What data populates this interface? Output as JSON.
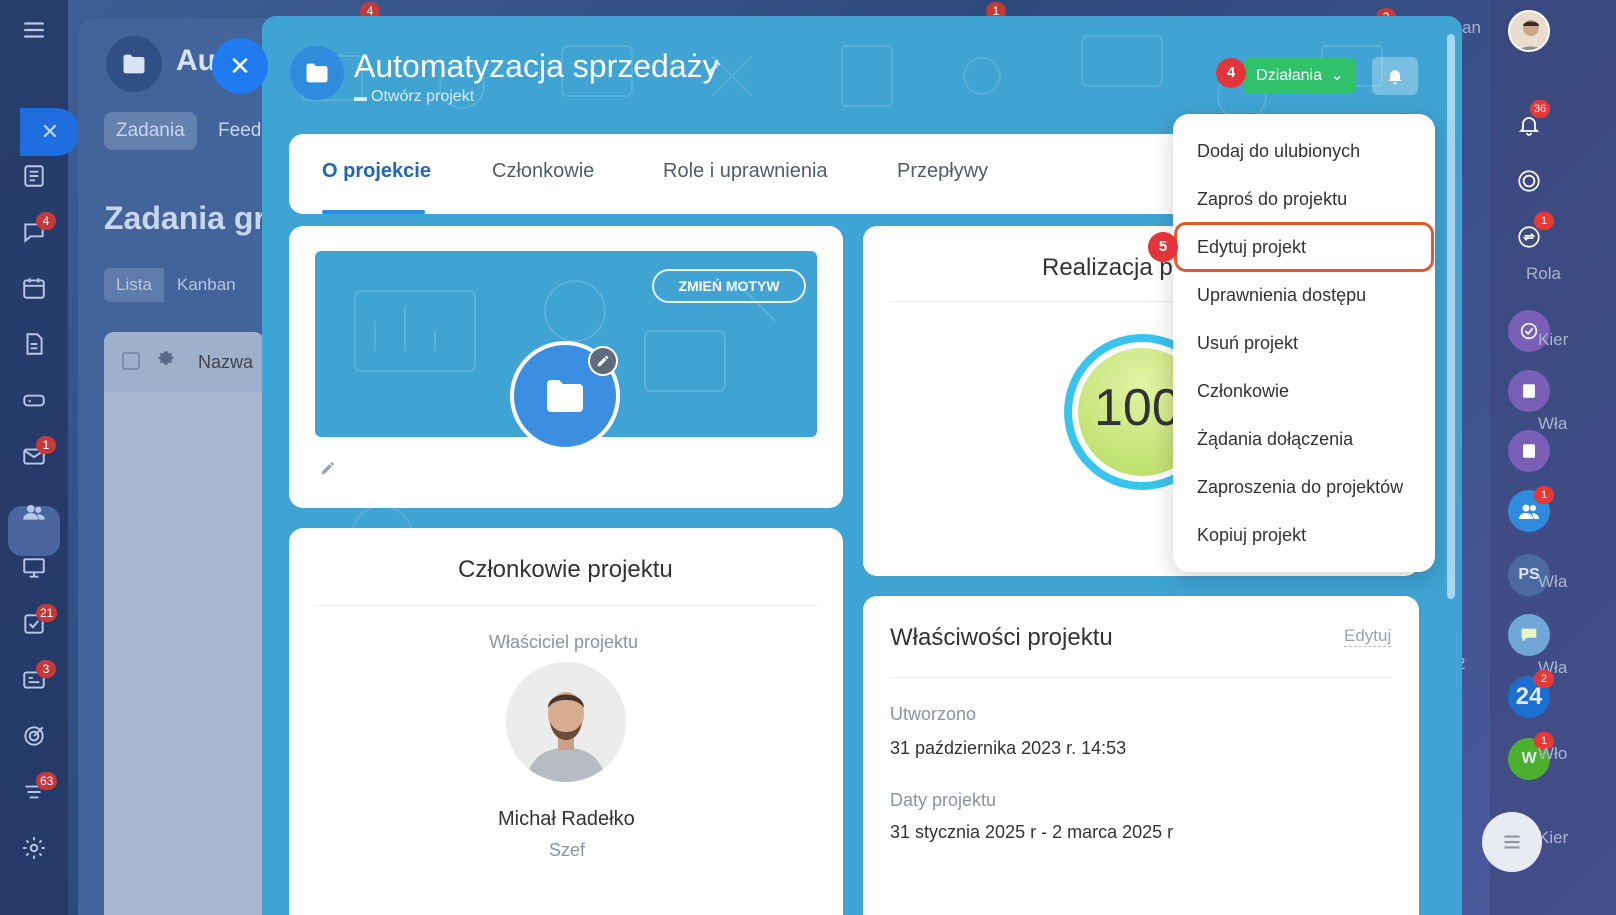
{
  "background": {
    "app_title_fragment": "Au",
    "tabs": [
      "Zadania",
      "Feed"
    ],
    "heading_fragment": "Zadania gr",
    "view_tabs": [
      "Lista",
      "Kanban"
    ],
    "table_header": "Nazwa",
    "left_rail_badges": [
      "4",
      "4",
      "1",
      "21",
      "3",
      "63"
    ],
    "top_badges": [
      "4",
      "1",
      "2"
    ]
  },
  "right_rail": {
    "notif_count": "36",
    "badge_1": "1",
    "role_label": "Rola",
    "badge_group": "1",
    "ps_initials": "PS",
    "b24_label": "24",
    "b24_badge": "2",
    "w_initial": "W",
    "w_badge": "1",
    "text_fragments": [
      "Kier",
      "Wła",
      "Wła",
      "Wła",
      "Kier",
      "Wło",
      "an",
      "2"
    ]
  },
  "project": {
    "title": "Automatyzacja sprzedaży",
    "open_link": "Otwórz projekt",
    "actions_label": "Działania",
    "step4": "4",
    "step5": "5"
  },
  "tabs": [
    "O projekcie",
    "Członkowie",
    "Role i uprawnienia",
    "Przepływy"
  ],
  "cover": {
    "change_theme": "ZMIEŃ MOTYW"
  },
  "members": {
    "title": "Członkowie projektu",
    "owner_label": "Właściciel projektu",
    "owner_name": "Michał Radełko",
    "owner_role": "Szef"
  },
  "realization": {
    "title_fragment": "Realizacja p",
    "value": "100"
  },
  "properties": {
    "title": "Właściwości projektu",
    "edit": "Edytuj",
    "created_label": "Utworzono",
    "created_value": "31 października 2023 r. 14:53",
    "dates_label": "Daty projektu",
    "dates_value": "31 stycznia 2025 r - 2 marca 2025 r"
  },
  "menu": {
    "items": [
      "Dodaj do ulubionych",
      "Zaproś do projektu",
      "Edytuj projekt",
      "Uprawnienia dostępu",
      "Usuń projekt",
      "Członkowie",
      "Żądania dołączenia",
      "Zaproszenia do projektów",
      "Kopiuj projekt"
    ],
    "highlighted": "Edytuj projekt"
  },
  "colors": {
    "slider_bg": "#3fa3d4",
    "accent_green": "#2fc26b",
    "badge_red": "#e2353b",
    "highlight_orange": "#e05a2f",
    "tab_active": "#2066b0"
  }
}
